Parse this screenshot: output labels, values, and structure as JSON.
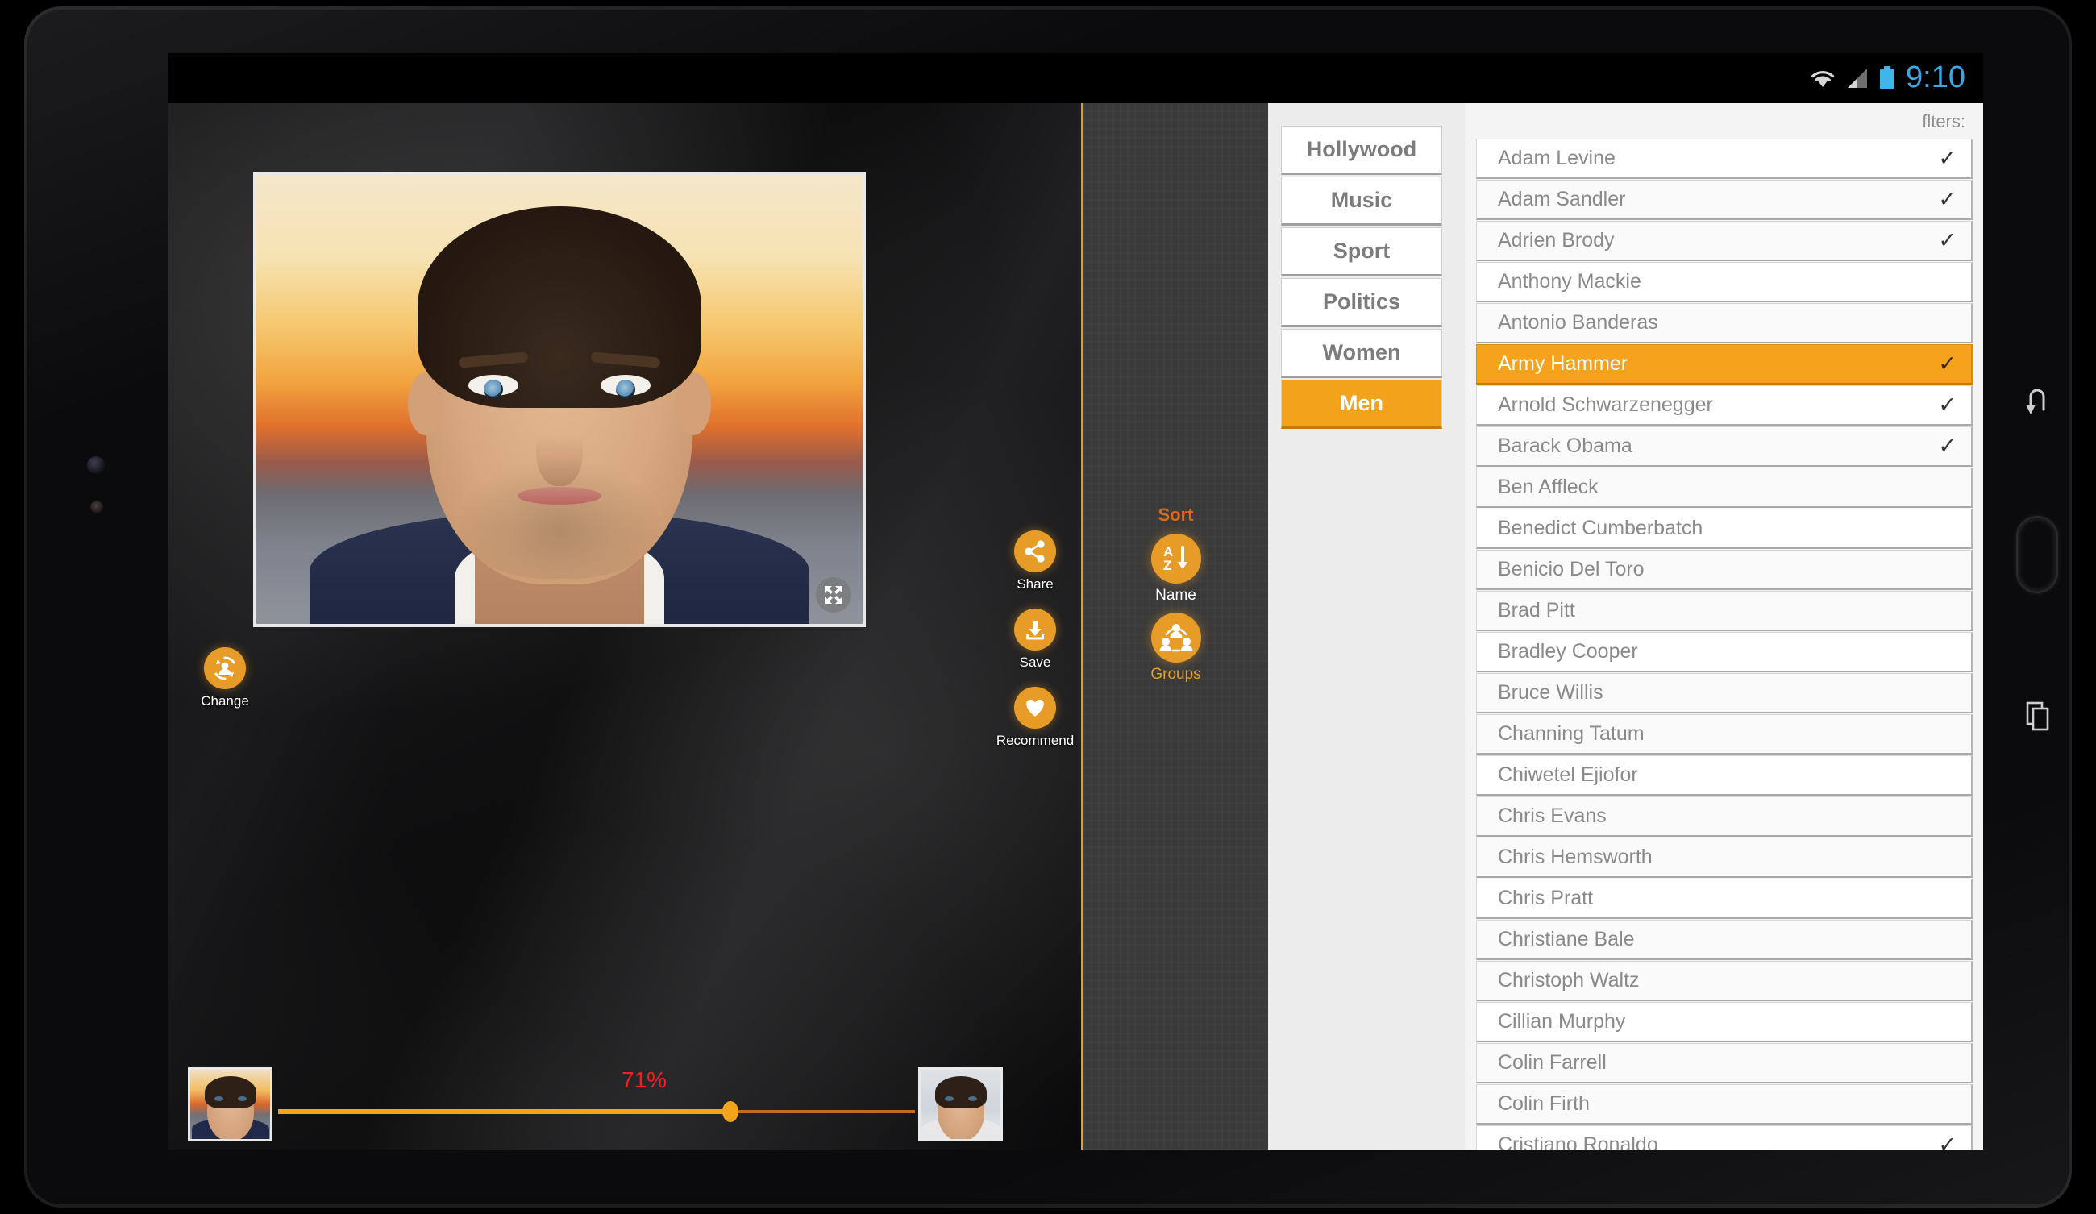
{
  "status_bar": {
    "time": "9:10",
    "icons": [
      "wifi-icon",
      "signal-icon",
      "battery-icon"
    ],
    "accent_color": "#3aa9e8"
  },
  "photo_panel": {
    "change_button": {
      "label": "Change",
      "icon": "change-person-icon"
    },
    "expand_button": {
      "icon": "expand-arrows-icon"
    },
    "actions": [
      {
        "label": "Share",
        "icon": "share-icon"
      },
      {
        "label": "Save",
        "icon": "download-icon"
      },
      {
        "label": "Recommend",
        "icon": "heart-icon"
      }
    ],
    "slider": {
      "percent_label": "71%",
      "percent_value": 71,
      "left_thumb_name": "source-face-thumbnail",
      "right_thumb_name": "target-face-thumbnail"
    }
  },
  "sort_panel": {
    "title": "Sort",
    "options": [
      {
        "label": "Name",
        "icon": "sort-alpha-icon"
      },
      {
        "label": "Groups",
        "icon": "groups-icon"
      }
    ]
  },
  "filters_panel": {
    "label": "flters:",
    "categories": [
      {
        "label": "Hollywood",
        "active": false
      },
      {
        "label": "Music",
        "active": false
      },
      {
        "label": "Sport",
        "active": false
      },
      {
        "label": "Politics",
        "active": false
      },
      {
        "label": "Women",
        "active": false
      },
      {
        "label": "Men",
        "active": true
      }
    ],
    "accent_color": "#f2a31b",
    "names": [
      {
        "name": "Adam Levine",
        "checked": true,
        "selected": false
      },
      {
        "name": "Adam Sandler",
        "checked": true,
        "selected": false
      },
      {
        "name": "Adrien Brody",
        "checked": true,
        "selected": false
      },
      {
        "name": "Anthony Mackie",
        "checked": false,
        "selected": false
      },
      {
        "name": "Antonio Banderas",
        "checked": false,
        "selected": false
      },
      {
        "name": "Army Hammer",
        "checked": true,
        "selected": true
      },
      {
        "name": "Arnold Schwarzenegger",
        "checked": true,
        "selected": false
      },
      {
        "name": "Barack Obama",
        "checked": true,
        "selected": false
      },
      {
        "name": "Ben Affleck",
        "checked": false,
        "selected": false
      },
      {
        "name": "Benedict Cumberbatch",
        "checked": false,
        "selected": false
      },
      {
        "name": "Benicio Del Toro",
        "checked": false,
        "selected": false
      },
      {
        "name": "Brad Pitt",
        "checked": false,
        "selected": false
      },
      {
        "name": "Bradley Cooper",
        "checked": false,
        "selected": false
      },
      {
        "name": "Bruce Willis",
        "checked": false,
        "selected": false
      },
      {
        "name": "Channing Tatum",
        "checked": false,
        "selected": false
      },
      {
        "name": "Chiwetel Ejiofor",
        "checked": false,
        "selected": false
      },
      {
        "name": "Chris Evans",
        "checked": false,
        "selected": false
      },
      {
        "name": "Chris Hemsworth",
        "checked": false,
        "selected": false
      },
      {
        "name": "Chris Pratt",
        "checked": false,
        "selected": false
      },
      {
        "name": "Christiane Bale",
        "checked": false,
        "selected": false
      },
      {
        "name": "Christoph Waltz",
        "checked": false,
        "selected": false
      },
      {
        "name": "Cillian Murphy",
        "checked": false,
        "selected": false
      },
      {
        "name": "Colin Farrell",
        "checked": false,
        "selected": false
      },
      {
        "name": "Colin Firth",
        "checked": false,
        "selected": false
      },
      {
        "name": "Cristiano Ronaldo",
        "checked": true,
        "selected": false
      }
    ],
    "check_glyph": "✓"
  },
  "device_nav": [
    {
      "name": "back-button",
      "icon": "back-arrow-icon"
    },
    {
      "name": "home-button",
      "icon": "home-pill-icon"
    },
    {
      "name": "recents-button",
      "icon": "recent-apps-icon"
    }
  ]
}
